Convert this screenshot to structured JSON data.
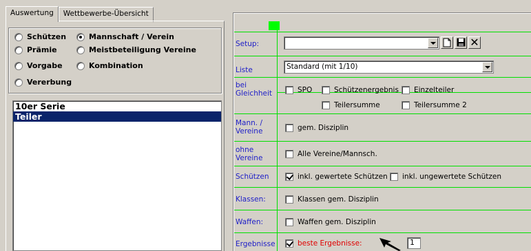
{
  "tabs": [
    {
      "label": "Auswertung",
      "active": true
    },
    {
      "label": "Wettbewerbe-Übersicht",
      "active": false
    }
  ],
  "radios": [
    {
      "label": "Schützen",
      "checked": false
    },
    {
      "label": "Mannschaft / Verein",
      "checked": true
    },
    {
      "label": "Prämie",
      "checked": false
    },
    {
      "label": "Meistbeteiligung Vereine",
      "checked": false
    },
    {
      "label": "Vorgabe",
      "checked": false
    },
    {
      "label": "Kombination",
      "checked": false
    },
    {
      "label": "Vererbung",
      "checked": false
    }
  ],
  "list": {
    "items": [
      {
        "label": "10er Serie",
        "selected": false
      },
      {
        "label": "Teiler",
        "selected": true
      }
    ]
  },
  "right": {
    "setup": {
      "label": "Setup:",
      "value": ""
    },
    "liste": {
      "label": "Liste",
      "value": "Standard (mit 1/10)"
    },
    "gleichheit": {
      "label": "bei Gleichheit",
      "options": [
        {
          "label": "SPO",
          "checked": false
        },
        {
          "label": "Schützenergebnis",
          "checked": false
        },
        {
          "label": "Einzelteiler",
          "checked": false
        },
        {
          "label": "Teilersumme",
          "checked": false
        },
        {
          "label": "Teilersumme 2",
          "checked": false
        }
      ]
    },
    "mann": {
      "label": "Mann. / Vereine",
      "option": {
        "label": "gem. Disziplin",
        "checked": false
      }
    },
    "ohne": {
      "label": "ohne Vereine",
      "option": {
        "label": "Alle Vereine/Mannsch.",
        "checked": false
      }
    },
    "schuetzen": {
      "label": "Schützen",
      "options": [
        {
          "label": "inkl. gewertete Schützen",
          "checked": true
        },
        {
          "label": "inkl. ungewertete Schützen",
          "checked": false
        }
      ]
    },
    "klassen": {
      "label": "Klassen:",
      "option": {
        "label": "Klassen gem. Disziplin",
        "checked": false
      }
    },
    "waffen": {
      "label": "Waffen:",
      "option": {
        "label": "Waffen gem. Disziplin",
        "checked": false
      }
    },
    "ergebnisse": {
      "label": "Ergebnisse",
      "option": {
        "label": "beste Ergebnisse:",
        "checked": true
      },
      "count": "1"
    }
  },
  "colors": {
    "label_blue": "#2020c8",
    "accent_green": "#00e000",
    "red_text": "#e00000",
    "selection": "#0a246a"
  }
}
